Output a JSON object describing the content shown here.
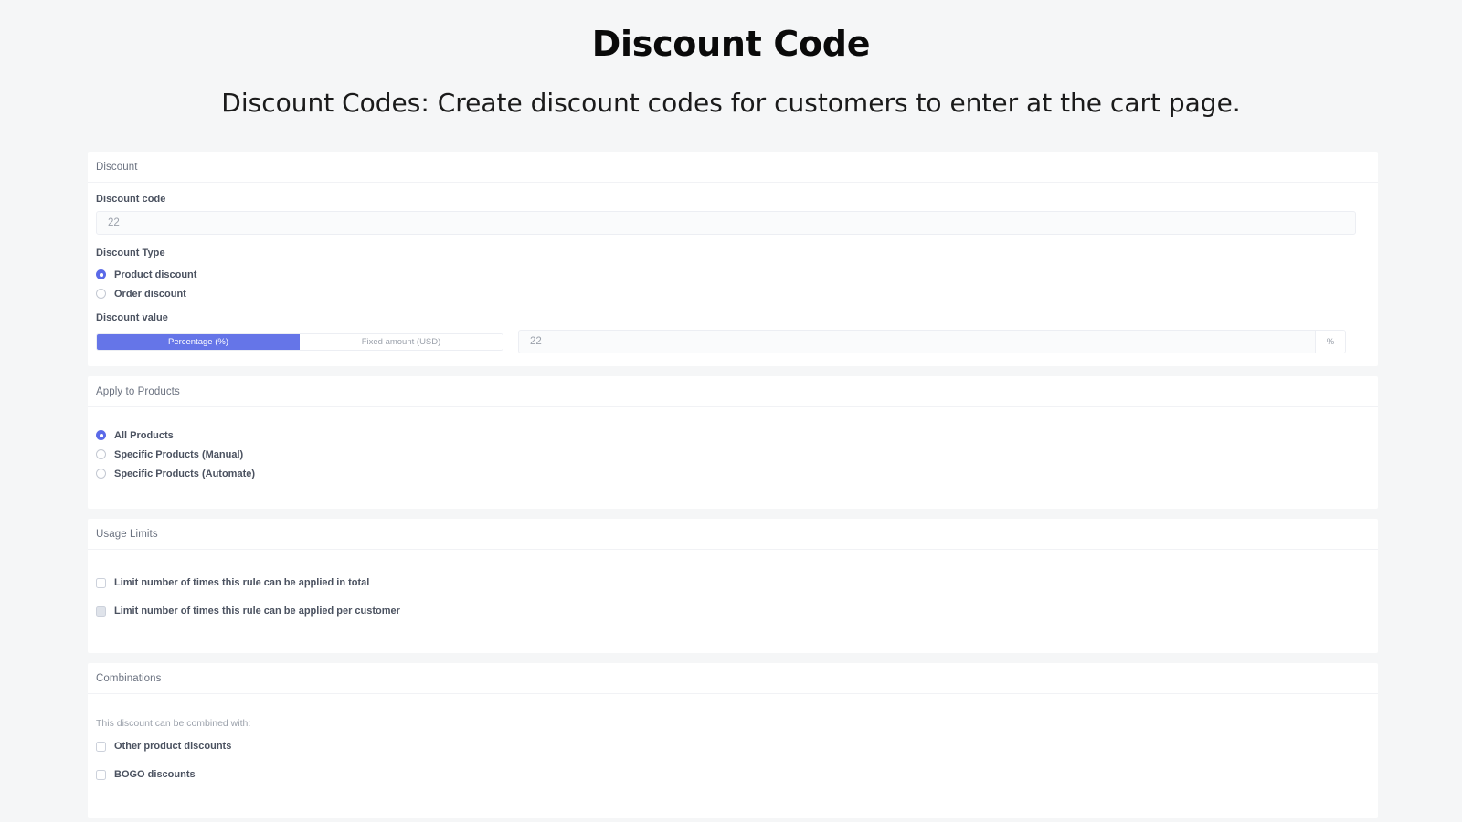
{
  "header": {
    "title": "Discount Code",
    "subtitle": "Discount Codes: Create discount codes for customers to enter at the cart page."
  },
  "colors": {
    "accent": "#6575e8",
    "radio_selected": "#5b6ae8",
    "page_background": "#f5f6f7",
    "card_background": "#ffffff",
    "label_text": "#4b5260",
    "muted_text": "#9ba1ab"
  },
  "discount_section": {
    "heading": "Discount",
    "code_label": "Discount code",
    "code_value": "22",
    "type_label": "Discount Type",
    "type_options": [
      {
        "label": "Product discount",
        "selected": true
      },
      {
        "label": "Order discount",
        "selected": false
      }
    ],
    "value_label": "Discount value",
    "value_modes": [
      {
        "label": "Percentage (%)",
        "active": true
      },
      {
        "label": "Fixed amount (USD)",
        "active": false
      }
    ],
    "value_amount": "22",
    "value_suffix": "%"
  },
  "apply_section": {
    "heading": "Apply to Products",
    "options": [
      {
        "label": "All Products",
        "selected": true
      },
      {
        "label": "Specific Products (Manual)",
        "selected": false
      },
      {
        "label": "Specific Products (Automate)",
        "selected": false
      }
    ]
  },
  "usage_section": {
    "heading": "Usage Limits",
    "options": [
      {
        "label": "Limit number of times this rule can be applied in total",
        "checked": false,
        "hovered": false
      },
      {
        "label": "Limit number of times this rule can be applied per customer",
        "checked": false,
        "hovered": true
      }
    ]
  },
  "combinations_section": {
    "heading": "Combinations",
    "helper": "This discount can be combined with:",
    "options": [
      {
        "label": "Other product discounts",
        "checked": false
      },
      {
        "label": "BOGO discounts",
        "checked": false
      }
    ]
  }
}
